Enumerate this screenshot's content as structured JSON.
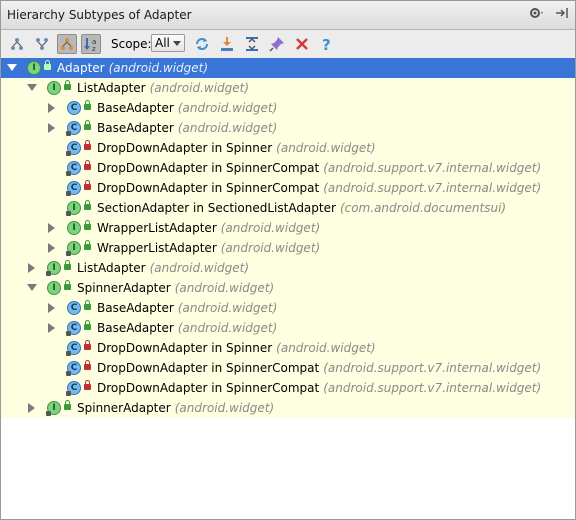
{
  "window": {
    "title": "Hierarchy Subtypes of Adapter"
  },
  "toolbar": {
    "scope_label": "Scope:",
    "scope_value": "All"
  },
  "tree": [
    {
      "indent": 0,
      "expander": "open",
      "kind": "iface",
      "letter": "I",
      "abstract": false,
      "lock": "pub",
      "name": "Adapter",
      "pkg": "(android.widget)",
      "selected": true
    },
    {
      "indent": 1,
      "expander": "open",
      "kind": "iface",
      "letter": "I",
      "abstract": false,
      "lock": "pub",
      "name": "ListAdapter",
      "pkg": "(android.widget)"
    },
    {
      "indent": 2,
      "expander": "closed",
      "kind": "cls",
      "letter": "C",
      "abstract": false,
      "lock": "pub",
      "name": "BaseAdapter",
      "pkg": "(android.widget)"
    },
    {
      "indent": 2,
      "expander": "closed",
      "kind": "cls",
      "letter": "C",
      "abstract": true,
      "lock": "pub",
      "name": "BaseAdapter",
      "pkg": "(android.widget)"
    },
    {
      "indent": 2,
      "expander": "none",
      "kind": "cls",
      "letter": "C",
      "abstract": true,
      "lock": "priv",
      "name": "DropDownAdapter in Spinner",
      "pkg": "(android.widget)"
    },
    {
      "indent": 2,
      "expander": "none",
      "kind": "cls",
      "letter": "C",
      "abstract": true,
      "lock": "priv",
      "name": "DropDownAdapter in SpinnerCompat",
      "pkg": "(android.support.v7.internal.widget)"
    },
    {
      "indent": 2,
      "expander": "none",
      "kind": "cls",
      "letter": "C",
      "abstract": true,
      "lock": "priv",
      "name": "DropDownAdapter in SpinnerCompat",
      "pkg": "(android.support.v7.internal.widget)"
    },
    {
      "indent": 2,
      "expander": "none",
      "kind": "iface",
      "letter": "I",
      "abstract": true,
      "lock": "pub",
      "name": "SectionAdapter in SectionedListAdapter",
      "pkg": "(com.android.documentsui)"
    },
    {
      "indent": 2,
      "expander": "closed",
      "kind": "iface",
      "letter": "I",
      "abstract": false,
      "lock": "pub",
      "name": "WrapperListAdapter",
      "pkg": "(android.widget)"
    },
    {
      "indent": 2,
      "expander": "closed",
      "kind": "iface",
      "letter": "I",
      "abstract": true,
      "lock": "pub",
      "name": "WrapperListAdapter",
      "pkg": "(android.widget)"
    },
    {
      "indent": 1,
      "expander": "closed",
      "kind": "iface",
      "letter": "I",
      "abstract": true,
      "lock": "pub",
      "name": "ListAdapter",
      "pkg": "(android.widget)"
    },
    {
      "indent": 1,
      "expander": "open",
      "kind": "iface",
      "letter": "I",
      "abstract": false,
      "lock": "pub",
      "name": "SpinnerAdapter",
      "pkg": "(android.widget)"
    },
    {
      "indent": 2,
      "expander": "closed",
      "kind": "cls",
      "letter": "C",
      "abstract": false,
      "lock": "pub",
      "name": "BaseAdapter",
      "pkg": "(android.widget)"
    },
    {
      "indent": 2,
      "expander": "closed",
      "kind": "cls",
      "letter": "C",
      "abstract": true,
      "lock": "pub",
      "name": "BaseAdapter",
      "pkg": "(android.widget)"
    },
    {
      "indent": 2,
      "expander": "none",
      "kind": "cls",
      "letter": "C",
      "abstract": true,
      "lock": "priv",
      "name": "DropDownAdapter in Spinner",
      "pkg": "(android.widget)"
    },
    {
      "indent": 2,
      "expander": "none",
      "kind": "cls",
      "letter": "C",
      "abstract": true,
      "lock": "priv",
      "name": "DropDownAdapter in SpinnerCompat",
      "pkg": "(android.support.v7.internal.widget)"
    },
    {
      "indent": 2,
      "expander": "none",
      "kind": "cls",
      "letter": "C",
      "abstract": true,
      "lock": "priv",
      "name": "DropDownAdapter in SpinnerCompat",
      "pkg": "(android.support.v7.internal.widget)"
    },
    {
      "indent": 1,
      "expander": "closed",
      "kind": "iface",
      "letter": "I",
      "abstract": true,
      "lock": "pub",
      "name": "SpinnerAdapter",
      "pkg": "(android.widget)"
    }
  ]
}
